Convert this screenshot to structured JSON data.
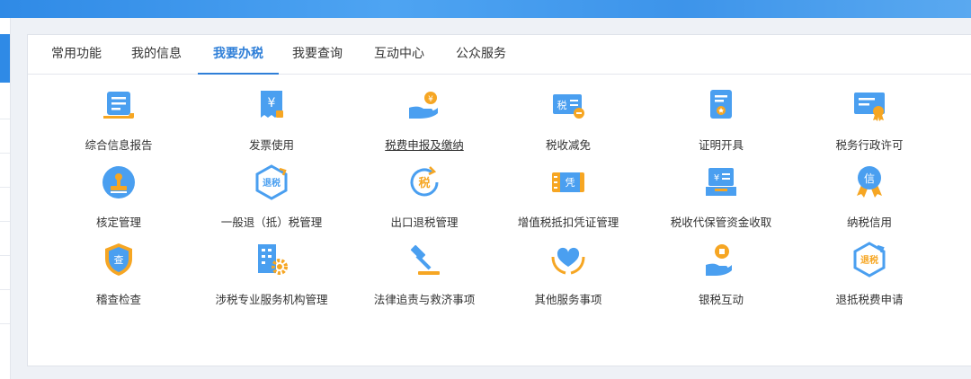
{
  "tabs": [
    {
      "label": "常用功能"
    },
    {
      "label": "我的信息"
    },
    {
      "label": "我要办税",
      "active": true
    },
    {
      "label": "我要查询"
    },
    {
      "label": "互动中心"
    },
    {
      "label": "公众服务"
    }
  ],
  "items": [
    {
      "label": "综合信息报告",
      "icon": "report-icon"
    },
    {
      "label": "发票使用",
      "icon": "invoice-icon"
    },
    {
      "label": "税费申报及缴纳",
      "icon": "tax-payment-icon"
    },
    {
      "label": "税收减免",
      "icon": "tax-reduction-icon"
    },
    {
      "label": "证明开具",
      "icon": "certificate-icon"
    },
    {
      "label": "税务行政许可",
      "icon": "license-icon"
    },
    {
      "label": "核定管理",
      "icon": "stamp-icon"
    },
    {
      "label": "一般退（抵）税管理",
      "icon": "refund-shield-icon"
    },
    {
      "label": "出口退税管理",
      "icon": "export-refund-icon"
    },
    {
      "label": "增值税抵扣凭证管理",
      "icon": "voucher-icon"
    },
    {
      "label": "税收代保管资金收取",
      "icon": "cash-register-icon"
    },
    {
      "label": "纳税信用",
      "icon": "credit-medal-icon"
    },
    {
      "label": "稽查检查",
      "icon": "inspect-shield-icon"
    },
    {
      "label": "涉税专业服务机构管理",
      "icon": "building-gear-icon"
    },
    {
      "label": "法律追责与救济事项",
      "icon": "gavel-icon"
    },
    {
      "label": "其他服务事项",
      "icon": "heart-hands-icon"
    },
    {
      "label": "银税互动",
      "icon": "coin-hand-icon"
    },
    {
      "label": "退抵税费申请",
      "icon": "refund-hex-icon"
    }
  ],
  "icon_texts": {
    "yen": "¥",
    "tax": "税",
    "refund": "退税",
    "voucher": "凭",
    "credit": "信",
    "inspect": "查"
  },
  "colors": {
    "accent": "#2f7fd8",
    "icon_blue": "#4a9ff0",
    "icon_orange": "#f6a623"
  }
}
